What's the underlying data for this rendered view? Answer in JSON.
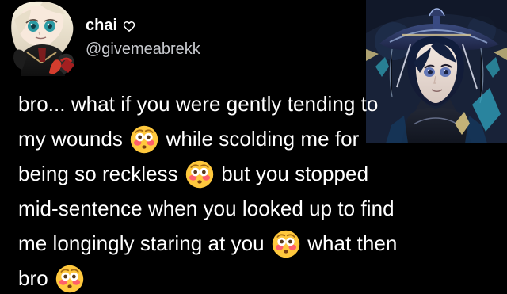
{
  "author": {
    "display_name": "chai",
    "username": "@givemeabrekk",
    "avatar_name": "avatar",
    "heart_icon": "heart-outline-icon"
  },
  "tweet": {
    "lines": [
      {
        "segments": [
          {
            "type": "text",
            "value": "bro... what if you were gently tending to"
          }
        ]
      },
      {
        "segments": [
          {
            "type": "text",
            "value": "my wounds"
          },
          {
            "type": "emoji",
            "name": "flushed-face-emoji"
          },
          {
            "type": "text",
            "value": "while scolding me for"
          }
        ]
      },
      {
        "segments": [
          {
            "type": "text",
            "value": "being so reckless"
          },
          {
            "type": "emoji",
            "name": "flushed-face-emoji"
          },
          {
            "type": "text",
            "value": "but you stopped"
          }
        ]
      },
      {
        "segments": [
          {
            "type": "text",
            "value": "mid-sentence when you looked up to find"
          }
        ]
      },
      {
        "segments": [
          {
            "type": "text",
            "value": "me longingly staring at you"
          },
          {
            "type": "emoji",
            "name": "flushed-face-emoji"
          },
          {
            "type": "text",
            "value": "what then"
          }
        ]
      },
      {
        "segments": [
          {
            "type": "text",
            "value": "bro"
          },
          {
            "type": "emoji",
            "name": "flushed-face-emoji"
          }
        ]
      }
    ]
  },
  "colors": {
    "background": "#000000",
    "primary_text": "#ffffff",
    "secondary_text": "#c6c8cd",
    "emoji_face": "#ffc83d",
    "emoji_blush": "#ff5a6b",
    "art_bg": "#1b2945"
  }
}
